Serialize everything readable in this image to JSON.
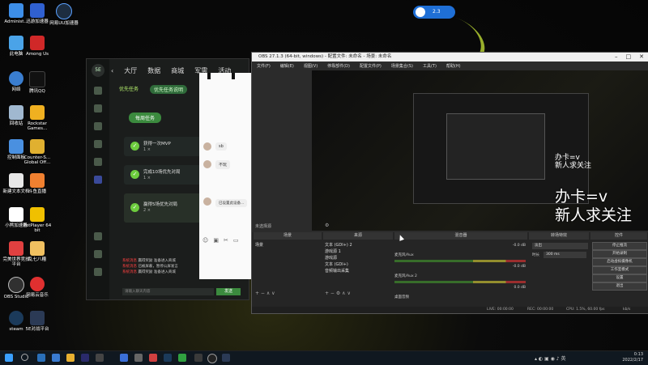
{
  "desktop": {
    "icons": [
      {
        "label": "Administ...",
        "color": "#3d8ee8"
      },
      {
        "label": "此电脑",
        "color": "#4aa3e8"
      },
      {
        "label": "网络",
        "color": "#3a7ed0"
      },
      {
        "label": "回收站",
        "color": "#a0b8d0"
      },
      {
        "label": "控制面板",
        "color": "#4a90e0"
      },
      {
        "label": "新建文本文档",
        "color": "#e8e8e8"
      },
      {
        "label": "小熊加速器",
        "color": "#ffffff"
      },
      {
        "label": "完美世界竞技平台",
        "color": "#e04040"
      },
      {
        "label": "OBS Studio",
        "color": "#303030"
      },
      {
        "label": "steam",
        "color": "#1b3a5a"
      },
      {
        "label": "迅游加速器",
        "color": "#3060d0"
      },
      {
        "label": "Among Us",
        "color": "#d02828"
      },
      {
        "label": "腾讯QQ",
        "color": "#111111"
      },
      {
        "label": "Rockstar Games...",
        "color": "#f0b020"
      },
      {
        "label": "Counter-S... Global Off...",
        "color": "#e0b030"
      },
      {
        "label": "斗鱼直播",
        "color": "#f08030"
      },
      {
        "label": "PotPlayer 64 bit",
        "color": "#f0c000"
      },
      {
        "label": "乱七八糟",
        "color": "#f0c060"
      },
      {
        "label": "网易云音乐",
        "color": "#e03030"
      },
      {
        "label": "5E对战平台",
        "color": "#2b3a55"
      },
      {
        "label": "网易UU加速器",
        "color": "#1d2d40"
      }
    ]
  },
  "widget": {
    "value": "2.3"
  },
  "client": {
    "nav": [
      "大厅",
      "数据",
      "商城",
      "军需",
      "活动"
    ],
    "tabs": {
      "active": "优先任务",
      "second": "优先任务说明"
    },
    "daily_button": "每周任务",
    "tasks": [
      {
        "title": "获得一次MVP",
        "sub": "1 ×"
      },
      {
        "title": "完成10场优先对局",
        "sub": "1 ×"
      },
      {
        "title": "赢得5场优先对局",
        "sub": "2 ×"
      }
    ],
    "chat_lines": [
      {
        "tag": "系统消息",
        "text": "赢得奖励 准备进入商城"
      },
      {
        "tag": "系统消息",
        "text": "已被屏蔽，暂停公屏发言"
      },
      {
        "tag": "系统消息",
        "text": "赢得奖励 准备进入商城"
      }
    ],
    "chat_placeholder": "请输入聊天内容",
    "send_label": "发送"
  },
  "chatpanel": {
    "messages": [
      "sb",
      "不玩"
    ],
    "notice": "已设置此设备..."
  },
  "obs": {
    "title": "OBS 27.1.3 (64-bit, windows) - 配置文件: 未命名 - 场景: 未命名",
    "menu": [
      "文件(F)",
      "编辑(E)",
      "视图(V)",
      "停靠部件(D)",
      "配置文件(P)",
      "场景集合(S)",
      "工具(T)",
      "帮助(H)"
    ],
    "mode_label": "未选择源",
    "overlay_small": [
      "办卡=v",
      "新人求关注"
    ],
    "overlay_big": [
      "办卡=v",
      "新人求关注"
    ],
    "docks": {
      "scenes": "场景",
      "sources": "来源",
      "mixer": "混音器",
      "transitions": "转场特效",
      "controls": "控件"
    },
    "scene_items": [
      "场景"
    ],
    "source_items": [
      "文本 (GDI+) 2",
      "游戏源 1",
      "游戏源",
      "文本 (GDI+)",
      "音频输出采集"
    ],
    "mixer_items": [
      {
        "name": "麦克风/Aux",
        "db": "-0.0 dB"
      },
      {
        "name": "麦克风/Aux 2",
        "db": "-0.0 dB"
      },
      {
        "name": "桌面音频",
        "db": "0.0 dB"
      }
    ],
    "transition": {
      "type": "淡出",
      "duration_label": "时长",
      "duration": "300 ms"
    },
    "controls": [
      "停止推流",
      "开始录制",
      "启动虚拟摄像机",
      "工作室模式",
      "设置",
      "退出"
    ],
    "status": {
      "live": "LIVE: 00:00:00",
      "rec": "REC: 00:00:00",
      "cpu": "CPU: 1.5%, 60.00 fps",
      "kbps": "kb/s"
    }
  },
  "taskbar": {
    "time": "0:13",
    "date": "2022/2/17"
  }
}
